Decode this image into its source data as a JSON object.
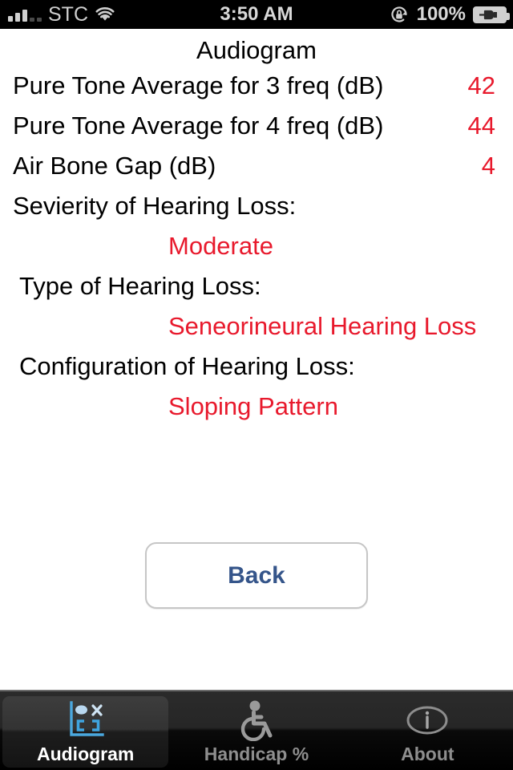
{
  "statusbar": {
    "signal_icon": "signal-bars-icon",
    "carrier": "STC",
    "wifi_icon": "wifi-icon",
    "time": "3:50 AM",
    "rotation_lock_icon": "rotation-lock-icon",
    "battery_percent": "100%",
    "battery_icon": "battery-charging-icon"
  },
  "main": {
    "title": "Audiogram",
    "rows": [
      {
        "label": "Pure Tone Average for 3 freq (dB)",
        "value": "42"
      },
      {
        "label": "Pure Tone Average for 4 freq (dB)",
        "value": "44"
      },
      {
        "label": "Air Bone Gap (dB)",
        "value": "4"
      }
    ],
    "blocks": [
      {
        "label": "Sevierity of Hearing Loss:",
        "value": "Moderate"
      },
      {
        "label": "Type of Hearing Loss:",
        "value": "Seneorineural Hearing Loss"
      },
      {
        "label": "Configuration of Hearing Loss:",
        "value": "Sloping Pattern"
      }
    ],
    "back_label": "Back"
  },
  "tabbar": {
    "tabs": [
      {
        "label": "Audiogram",
        "icon": "audiogram-chart-icon",
        "active": true
      },
      {
        "label": "Handicap %",
        "icon": "wheelchair-icon",
        "active": false
      },
      {
        "label": "About",
        "icon": "info-icon",
        "active": false
      }
    ]
  },
  "colors": {
    "value_red": "#e8192c",
    "back_blue": "#35558a",
    "tab_accent_blue": "#5bb8e8"
  }
}
